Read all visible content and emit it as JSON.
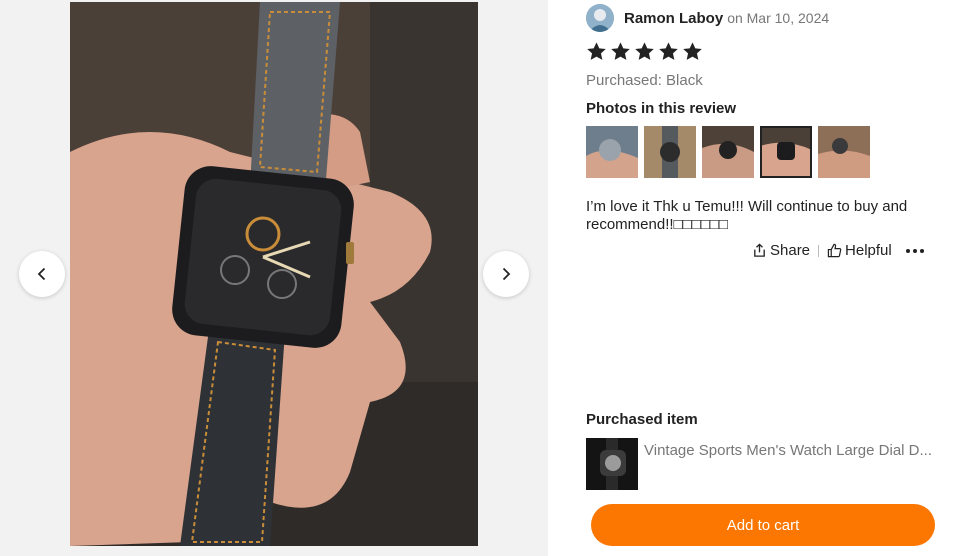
{
  "review": {
    "reviewer_name": "Ramon Laboy",
    "date": "on Mar 10, 2024",
    "rating": 5,
    "purchased": "Purchased: Black",
    "photos_title": "Photos in this review",
    "text": "I’m love it Thk u Temu!!! Will continue to buy and recommend!!□□□□□□",
    "actions": {
      "share_label": "Share",
      "helpful_label": "Helpful"
    }
  },
  "icons": {
    "prev": "chevron-left-icon",
    "next": "chevron-right-icon",
    "share": "share-icon",
    "helpful": "thumbs-up-icon",
    "more": "more-horizontal-icon",
    "star": "star-icon"
  },
  "purchased_item": {
    "title": "Purchased item",
    "name": "Vintage Sports Men's Watch Large Dial D..."
  },
  "cart": {
    "label": "Add to cart",
    "color": "#fb7701"
  }
}
